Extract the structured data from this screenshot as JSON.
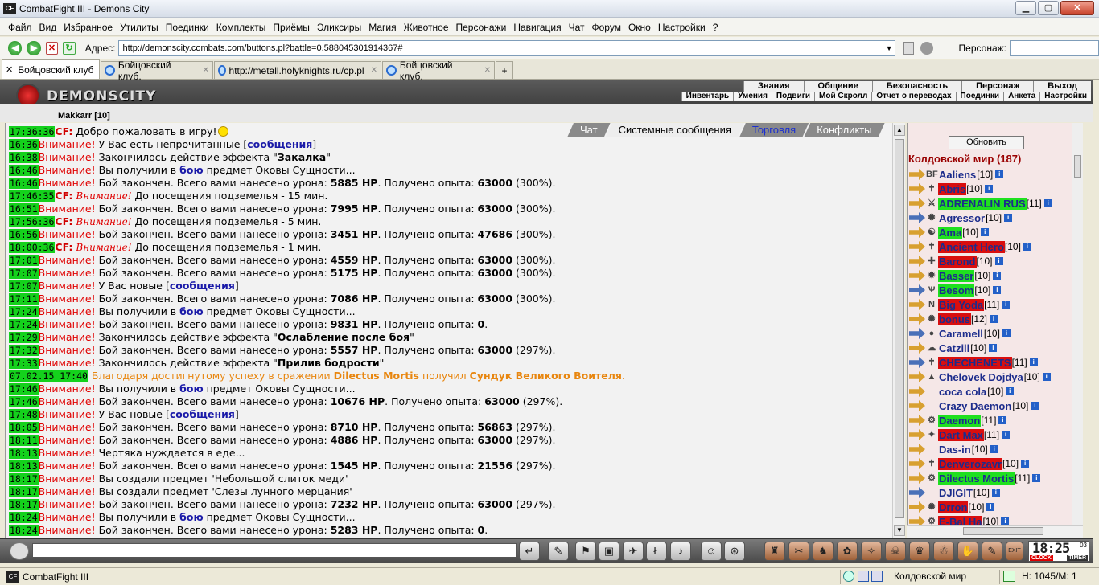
{
  "window": {
    "title": "CombatFight III - Demons City",
    "icon_text": "CF"
  },
  "menu": [
    "Файл",
    "Вид",
    "Избранное",
    "Утилиты",
    "Поединки",
    "Комплекты",
    "Приёмы",
    "Эликсиры",
    "Магия",
    "Животное",
    "Персонажи",
    "Навигация",
    "Чат",
    "Форум",
    "Окно",
    "Настройки",
    "?"
  ],
  "address": {
    "label": "Адрес:",
    "url": "http://demonscity.combats.com/buttons.pl?battle=0.588045301914367#"
  },
  "persona": {
    "label": "Персонаж:",
    "value": ""
  },
  "browser_tabs": [
    {
      "label": "Бойцовский клуб",
      "active": true
    },
    {
      "label": "Бойцовский клуб.",
      "active": false
    },
    {
      "label": "http://metall.holyknights.ru/cp.pl",
      "active": false
    },
    {
      "label": "Бойцовский клуб.",
      "active": false
    }
  ],
  "game": {
    "logo": "DEMONSCITY",
    "top_nav": [
      "Знания",
      "Общение",
      "Безопасность",
      "Персонаж",
      "Выход"
    ],
    "sub_nav": [
      "Инвентарь",
      "Умения",
      "Подвиги",
      "Мой Скролл",
      "Отчет о переводах",
      "Поединки",
      "Анкета",
      "Настройки"
    ],
    "under_user": "Makkarr [10]"
  },
  "chat_tabs": [
    {
      "label": "Чат",
      "state": "inactive"
    },
    {
      "label": "Системные сообщения",
      "state": "active"
    },
    {
      "label": "Торговля",
      "state": "blue"
    },
    {
      "label": "Конфликты",
      "state": "inactive"
    }
  ],
  "chat": [
    {
      "time": "17:36:36",
      "segs": [
        {
          "t": "CF:",
          "c": "cfname"
        },
        {
          "t": " Добро пожаловать в игру!"
        },
        {
          "t": "",
          "c": "smile"
        }
      ]
    },
    {
      "time": "16:36",
      "segs": [
        {
          "t": "Внимание!",
          "c": "alert"
        },
        {
          "t": " У Вас есть непрочитанные ["
        },
        {
          "t": "сообщения",
          "c": "lnk"
        },
        {
          "t": "]"
        }
      ]
    },
    {
      "time": "16:38",
      "segs": [
        {
          "t": "Внимание!",
          "c": "alert"
        },
        {
          "t": " Закончилось действие эффекта \""
        },
        {
          "t": "Закалка",
          "c": "b"
        },
        {
          "t": "\""
        }
      ]
    },
    {
      "time": "16:46",
      "segs": [
        {
          "t": "Внимание!",
          "c": "alert"
        },
        {
          "t": " Вы получили в "
        },
        {
          "t": "бою",
          "c": "lnk"
        },
        {
          "t": " предмет Оковы Сущности..."
        }
      ]
    },
    {
      "time": "16:46",
      "segs": [
        {
          "t": "Внимание!",
          "c": "alert"
        },
        {
          "t": " Бой закончен. Всего вами нанесено урона: "
        },
        {
          "t": "5885 HP",
          "c": "b"
        },
        {
          "t": ". Получено опыта: "
        },
        {
          "t": "63000",
          "c": "b"
        },
        {
          "t": " (300%)."
        }
      ]
    },
    {
      "time": "17:46:35",
      "segs": [
        {
          "t": "CF:",
          "c": "cfname"
        },
        {
          "t": " "
        },
        {
          "t": "Внимание!",
          "c": "alert ital"
        },
        {
          "t": " До посещения подземелья - 15 мин."
        }
      ]
    },
    {
      "time": "16:51",
      "segs": [
        {
          "t": "Внимание!",
          "c": "alert"
        },
        {
          "t": " Бой закончен. Всего вами нанесено урона: "
        },
        {
          "t": "7995 HP",
          "c": "b"
        },
        {
          "t": ". Получено опыта: "
        },
        {
          "t": "63000",
          "c": "b"
        },
        {
          "t": " (300%)."
        }
      ]
    },
    {
      "time": "17:56:36",
      "segs": [
        {
          "t": "CF:",
          "c": "cfname"
        },
        {
          "t": " "
        },
        {
          "t": "Внимание!",
          "c": "alert ital"
        },
        {
          "t": " До посещения подземелья - 5 мин."
        }
      ]
    },
    {
      "time": "16:56",
      "segs": [
        {
          "t": "Внимание!",
          "c": "alert"
        },
        {
          "t": " Бой закончен. Всего вами нанесено урона: "
        },
        {
          "t": "3451 HP",
          "c": "b"
        },
        {
          "t": ". Получено опыта: "
        },
        {
          "t": "47686",
          "c": "b"
        },
        {
          "t": " (300%)."
        }
      ]
    },
    {
      "time": "18:00:36",
      "segs": [
        {
          "t": "CF:",
          "c": "cfname"
        },
        {
          "t": " "
        },
        {
          "t": "Внимание!",
          "c": "alert ital"
        },
        {
          "t": " До посещения подземелья - 1 мин."
        }
      ]
    },
    {
      "time": "17:01",
      "segs": [
        {
          "t": "Внимание!",
          "c": "alert"
        },
        {
          "t": " Бой закончен. Всего вами нанесено урона: "
        },
        {
          "t": "4559 HP",
          "c": "b"
        },
        {
          "t": ". Получено опыта: "
        },
        {
          "t": "63000",
          "c": "b"
        },
        {
          "t": " (300%)."
        }
      ]
    },
    {
      "time": "17:07",
      "segs": [
        {
          "t": "Внимание!",
          "c": "alert"
        },
        {
          "t": " Бой закончен. Всего вами нанесено урона: "
        },
        {
          "t": "5175 HP",
          "c": "b"
        },
        {
          "t": ". Получено опыта: "
        },
        {
          "t": "63000",
          "c": "b"
        },
        {
          "t": " (300%)."
        }
      ]
    },
    {
      "time": "17:07",
      "segs": [
        {
          "t": "Внимание!",
          "c": "alert"
        },
        {
          "t": " У Вас новые ["
        },
        {
          "t": "сообщения",
          "c": "lnk"
        },
        {
          "t": "]"
        }
      ]
    },
    {
      "time": "17:11",
      "segs": [
        {
          "t": "Внимание!",
          "c": "alert"
        },
        {
          "t": " Бой закончен. Всего вами нанесено урона: "
        },
        {
          "t": "7086 HP",
          "c": "b"
        },
        {
          "t": ". Получено опыта: "
        },
        {
          "t": "63000",
          "c": "b"
        },
        {
          "t": " (300%)."
        }
      ]
    },
    {
      "time": "17:24",
      "segs": [
        {
          "t": "Внимание!",
          "c": "alert"
        },
        {
          "t": " Вы получили в "
        },
        {
          "t": "бою",
          "c": "lnk"
        },
        {
          "t": " предмет Оковы Сущности..."
        }
      ]
    },
    {
      "time": "17:24",
      "segs": [
        {
          "t": "Внимание!",
          "c": "alert"
        },
        {
          "t": " Бой закончен. Всего вами нанесено урона: "
        },
        {
          "t": "9831 HP",
          "c": "b"
        },
        {
          "t": ". Получено опыта: "
        },
        {
          "t": "0",
          "c": "b"
        },
        {
          "t": "."
        }
      ]
    },
    {
      "time": "17:29",
      "segs": [
        {
          "t": "Внимание!",
          "c": "alert"
        },
        {
          "t": " Закончилось действие эффекта \""
        },
        {
          "t": "Ослабление после боя",
          "c": "b"
        },
        {
          "t": "\""
        }
      ]
    },
    {
      "time": "17:32",
      "segs": [
        {
          "t": "Внимание!",
          "c": "alert"
        },
        {
          "t": " Бой закончен. Всего вами нанесено урона: "
        },
        {
          "t": "5557 HP",
          "c": "b"
        },
        {
          "t": ". Получено опыта: "
        },
        {
          "t": "63000",
          "c": "b"
        },
        {
          "t": " (297%)."
        }
      ]
    },
    {
      "time": "17:33",
      "segs": [
        {
          "t": "Внимание!",
          "c": "alert"
        },
        {
          "t": " Закончилось действие эффекта \""
        },
        {
          "t": "Прилив бодрости",
          "c": "b"
        },
        {
          "t": "\""
        }
      ]
    },
    {
      "time": "07.02.15 17:40",
      "segs": [
        {
          "t": " Благодаря достигнутому успеху в сражении ",
          "c": "orange"
        },
        {
          "t": "Dilectus Mortis",
          "c": "orange b"
        },
        {
          "t": " получил ",
          "c": "orange"
        },
        {
          "t": "Сундук Великого Воителя",
          "c": "orange b"
        },
        {
          "t": ".",
          "c": "orange"
        }
      ]
    },
    {
      "time": "17:46",
      "segs": [
        {
          "t": "Внимание!",
          "c": "alert"
        },
        {
          "t": " Вы получили в "
        },
        {
          "t": "бою",
          "c": "lnk"
        },
        {
          "t": " предмет Оковы Сущности..."
        }
      ]
    },
    {
      "time": "17:46",
      "segs": [
        {
          "t": "Внимание!",
          "c": "alert"
        },
        {
          "t": " Бой закончен. Всего вами нанесено урона: "
        },
        {
          "t": "10676 HP",
          "c": "b"
        },
        {
          "t": ". Получено опыта: "
        },
        {
          "t": "63000",
          "c": "b"
        },
        {
          "t": " (297%)."
        }
      ]
    },
    {
      "time": "17:48",
      "segs": [
        {
          "t": "Внимание!",
          "c": "alert"
        },
        {
          "t": " У Вас новые ["
        },
        {
          "t": "сообщения",
          "c": "lnk"
        },
        {
          "t": "]"
        }
      ]
    },
    {
      "time": "18:05",
      "segs": [
        {
          "t": "Внимание!",
          "c": "alert"
        },
        {
          "t": " Бой закончен. Всего вами нанесено урона: "
        },
        {
          "t": "8710 HP",
          "c": "b"
        },
        {
          "t": ". Получено опыта: "
        },
        {
          "t": "56863",
          "c": "b"
        },
        {
          "t": " (297%)."
        }
      ]
    },
    {
      "time": "18:11",
      "segs": [
        {
          "t": "Внимание!",
          "c": "alert"
        },
        {
          "t": " Бой закончен. Всего вами нанесено урона: "
        },
        {
          "t": "4886 HP",
          "c": "b"
        },
        {
          "t": ". Получено опыта: "
        },
        {
          "t": "63000",
          "c": "b"
        },
        {
          "t": " (297%)."
        }
      ]
    },
    {
      "time": "18:13",
      "segs": [
        {
          "t": "Внимание!",
          "c": "alert"
        },
        {
          "t": " Чертяка нуждается в еде..."
        }
      ]
    },
    {
      "time": "18:13",
      "segs": [
        {
          "t": "Внимание!",
          "c": "alert"
        },
        {
          "t": " Бой закончен. Всего вами нанесено урона: "
        },
        {
          "t": "1545 HP",
          "c": "b"
        },
        {
          "t": ". Получено опыта: "
        },
        {
          "t": "21556",
          "c": "b"
        },
        {
          "t": " (297%)."
        }
      ]
    },
    {
      "time": "18:17",
      "segs": [
        {
          "t": "Внимание!",
          "c": "alert"
        },
        {
          "t": " Вы создали предмет 'Небольшой слиток меди'"
        }
      ]
    },
    {
      "time": "18:17",
      "segs": [
        {
          "t": "Внимание!",
          "c": "alert"
        },
        {
          "t": " Вы создали предмет 'Слезы лунного мерцания'"
        }
      ]
    },
    {
      "time": "18:17",
      "segs": [
        {
          "t": "Внимание!",
          "c": "alert"
        },
        {
          "t": " Бой закончен. Всего вами нанесено урона: "
        },
        {
          "t": "7232 HP",
          "c": "b"
        },
        {
          "t": ". Получено опыта: "
        },
        {
          "t": "63000",
          "c": "b"
        },
        {
          "t": " (297%)."
        }
      ]
    },
    {
      "time": "18:24",
      "segs": [
        {
          "t": "Внимание!",
          "c": "alert"
        },
        {
          "t": " Вы получили в "
        },
        {
          "t": "бою",
          "c": "lnk"
        },
        {
          "t": " предмет Оковы Сущности..."
        }
      ]
    },
    {
      "time": "18:24",
      "segs": [
        {
          "t": "Внимание!",
          "c": "alert"
        },
        {
          "t": " Бой закончен. Всего вами нанесено урона: "
        },
        {
          "t": "5283 HP",
          "c": "b"
        },
        {
          "t": ". Получено опыта: "
        },
        {
          "t": "0",
          "c": "b"
        },
        {
          "t": "."
        }
      ]
    }
  ],
  "sidebar": {
    "refresh_label": "Обновить",
    "world_title": "Колдовской мир (187)",
    "users": [
      {
        "name": "Aaliens",
        "level": "[10]",
        "hl": "",
        "icon": "o",
        "glyph": "BF"
      },
      {
        "name": "Abris",
        "level": "[10]",
        "hl": "red",
        "icon": "o",
        "glyph": "✝"
      },
      {
        "name": "ADRENALIN RUS",
        "level": "[11]",
        "hl": "green",
        "icon": "o",
        "glyph": "⚔"
      },
      {
        "name": "Agressor",
        "level": "[10]",
        "hl": "",
        "icon": "b",
        "glyph": "✺"
      },
      {
        "name": "Ama",
        "level": "[10]",
        "hl": "green",
        "icon": "o",
        "glyph": "☯"
      },
      {
        "name": "Ancient Hero",
        "level": "[10]",
        "hl": "red",
        "icon": "o",
        "glyph": "✝"
      },
      {
        "name": "Barond",
        "level": "[10]",
        "hl": "red",
        "icon": "o",
        "glyph": "✚"
      },
      {
        "name": "Basser",
        "level": "[10]",
        "hl": "green",
        "icon": "o",
        "glyph": "✹"
      },
      {
        "name": "Besom",
        "level": "[10]",
        "hl": "green",
        "icon": "b",
        "glyph": "Ѱ"
      },
      {
        "name": "Big Yoda",
        "level": "[11]",
        "hl": "red",
        "icon": "o",
        "glyph": "N"
      },
      {
        "name": "bonus",
        "level": "[12]",
        "hl": "red",
        "icon": "o",
        "glyph": "✺"
      },
      {
        "name": "Caramell",
        "level": "[10]",
        "hl": "",
        "icon": "b",
        "glyph": "●"
      },
      {
        "name": "Catzill",
        "level": "[10]",
        "hl": "",
        "icon": "o",
        "glyph": "☁"
      },
      {
        "name": "CHECHENETS",
        "level": "[11]",
        "hl": "red",
        "icon": "b",
        "glyph": "✝"
      },
      {
        "name": "Chelovek Dojdya",
        "level": "[10]",
        "hl": "",
        "icon": "o",
        "glyph": "▲"
      },
      {
        "name": "coca cola",
        "level": "[10]",
        "hl": "",
        "icon": "o",
        "glyph": ""
      },
      {
        "name": "Crazy Daemon",
        "level": "[10]",
        "hl": "",
        "icon": "o",
        "glyph": ""
      },
      {
        "name": "Daemon",
        "level": "[11]",
        "hl": "green",
        "icon": "o",
        "glyph": "⚙"
      },
      {
        "name": "Dart Max",
        "level": "[11]",
        "hl": "red",
        "icon": "o",
        "glyph": "✦"
      },
      {
        "name": "Das-in",
        "level": "[10]",
        "hl": "",
        "icon": "o",
        "glyph": ""
      },
      {
        "name": "Denverozavr",
        "level": "[10]",
        "hl": "red",
        "icon": "o",
        "glyph": "✝"
      },
      {
        "name": "Dilectus Mortis",
        "level": "[11]",
        "hl": "green",
        "icon": "o",
        "glyph": "⚙"
      },
      {
        "name": "DJIGIT",
        "level": "[10]",
        "hl": "",
        "icon": "b",
        "glyph": ""
      },
      {
        "name": "Drron",
        "level": "[10]",
        "hl": "red",
        "icon": "o",
        "glyph": "✺"
      },
      {
        "name": "E-Bal Ha",
        "level": "[10]",
        "hl": "red",
        "icon": "o",
        "glyph": "⚙"
      }
    ]
  },
  "bottom": {
    "buttons_left": [
      "↵",
      "✎",
      "⚑",
      "▣",
      "✈",
      "Ł",
      "♪",
      "☺",
      "⊛"
    ],
    "buttons_right": [
      "♜",
      "✂",
      "♞",
      "✿",
      "✧",
      "☠",
      "♛",
      "☃",
      "✋",
      "✎",
      "EXIT"
    ],
    "clock_time": "18:25",
    "clock_sec": "03",
    "clock_label": "CLOCK",
    "timer_label": "TIMER"
  },
  "status": {
    "app": "CombatFight III",
    "icon_text": "CF",
    "world": "Колдовской мир",
    "hp": "H: 1045/M: 1"
  }
}
